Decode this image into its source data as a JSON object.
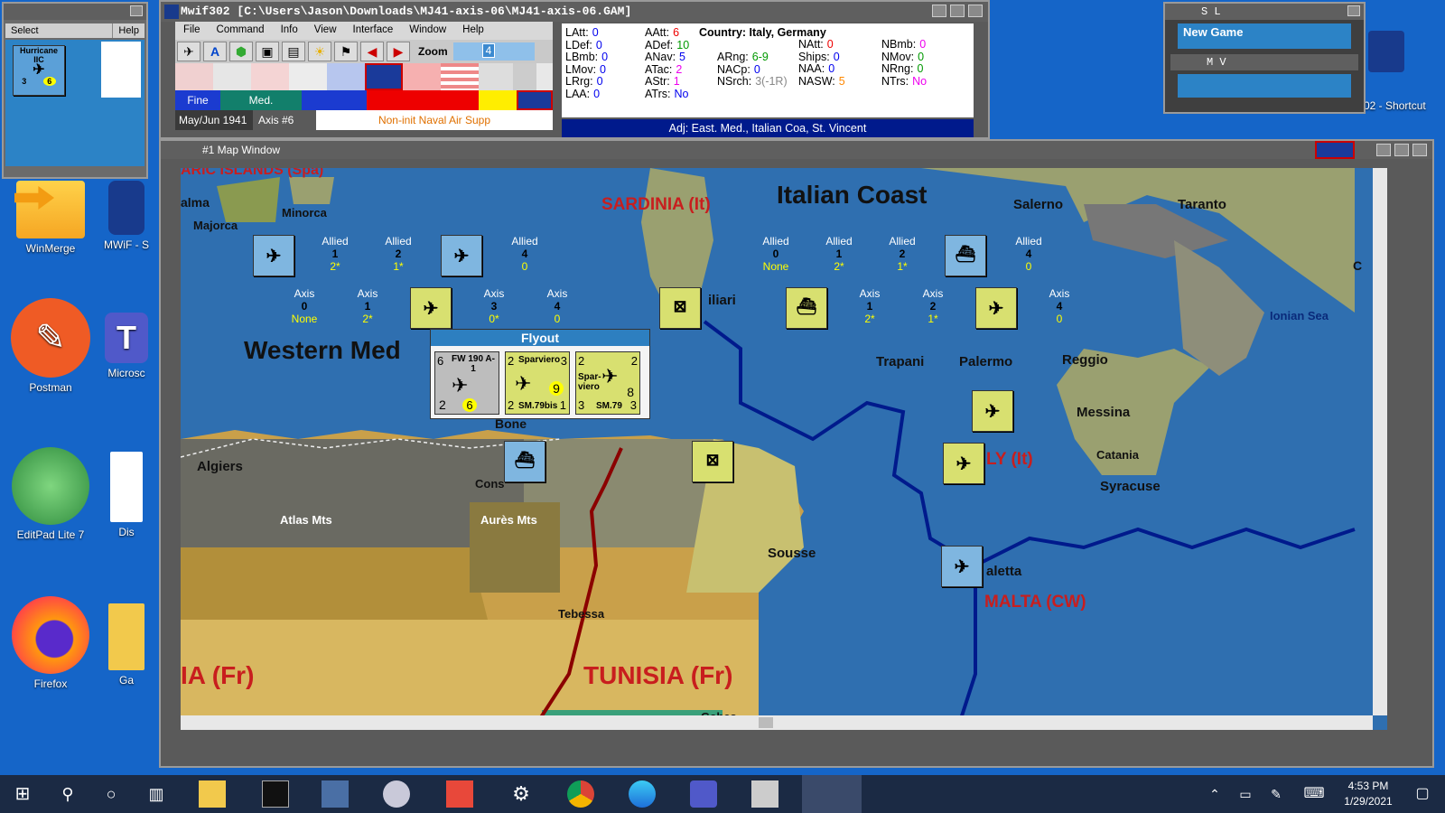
{
  "desktop": {
    "icons": [
      {
        "label": "WinMerge"
      },
      {
        "label": "MWiF - S"
      },
      {
        "label": "Postman"
      },
      {
        "label": "Microsc"
      },
      {
        "label": "EditPad Lite 7"
      },
      {
        "label": "Dis"
      },
      {
        "label": "Firefox"
      },
      {
        "label": "Ga"
      }
    ],
    "shortcut_label": "02 - Shortcut"
  },
  "select_window": {
    "menu": [
      "Select",
      "Help"
    ],
    "counter_name": "Hurricane",
    "counter_top": "IIC",
    "counter_a": "3",
    "counter_b": "6"
  },
  "sl_window": {
    "title": "S L",
    "new_game": "New Game",
    "mv_title": "M V"
  },
  "main_window": {
    "title": "Mwif302 [C:\\Users\\Jason\\Downloads\\MJ41-axis-06\\MJ41-axis-06.GAM]",
    "menu": [
      "File",
      "Command",
      "Info",
      "View",
      "Interface",
      "Window",
      "Help"
    ],
    "zoom_label": "Zoom",
    "zoom_value": "4",
    "weather": [
      "Fine",
      "Med."
    ],
    "date": "May/Jun 1941",
    "turn": "Axis #6",
    "phase": "Non-init Naval Air Supp",
    "adjacent": "Adj: East. Med., Italian Coa, St. Vincent"
  },
  "info_panel": {
    "country": "Country: Italy, Germany",
    "col1": [
      [
        "LAtt:",
        "0"
      ],
      [
        "LDef:",
        "0"
      ],
      [
        "LBmb:",
        "0"
      ],
      [
        "LMov:",
        "0"
      ],
      [
        "LRrg:",
        "0"
      ],
      [
        "LAA:",
        "0"
      ]
    ],
    "col2": [
      [
        "AAtt:",
        "6"
      ],
      [
        "ADef:",
        "10"
      ],
      [
        "ANav:",
        "5"
      ],
      [
        "ATac:",
        "2"
      ],
      [
        "AStr:",
        "1"
      ],
      [
        "ATrs:",
        "No"
      ]
    ],
    "col3": [
      [
        "ARng:",
        "6-9"
      ],
      [
        "NACp:",
        "0"
      ],
      [
        "NSrch:",
        "3(-1R)"
      ]
    ],
    "col4": [
      [
        "NAtt:",
        "0"
      ],
      [
        "Ships:",
        "0"
      ],
      [
        "NAA:",
        "0"
      ],
      [
        "NASW:",
        "5"
      ]
    ],
    "col5": [
      [
        "NBmb:",
        "0"
      ],
      [
        "NMov:",
        "0"
      ],
      [
        "NRng:",
        "0"
      ],
      [
        "NTrs:",
        "No"
      ]
    ]
  },
  "map_window": {
    "title": "#1 Map Window",
    "sea_labels": [
      "Western Med",
      "Italian Coast",
      "Ionian Sea"
    ],
    "country_labels": [
      "SARDINIA (It)",
      "TUNISIA (Fr)",
      "IA (Fr)",
      "MALTA (CW)",
      "LY (It)"
    ],
    "places": [
      "ARIC ISLANDS (Spa)",
      "alma",
      "Minorca",
      "Majorca",
      "Algiers",
      "Atlas Mts",
      "Aurès Mts",
      "Bone",
      "Cons",
      "Tebessa",
      "Sousse",
      "Gabes",
      "Trapani",
      "Palermo",
      "Reggio",
      "Messina",
      "Catania",
      "Syracuse",
      "Salerno",
      "Taranto",
      "aletta",
      "iliari",
      "C"
    ],
    "allied_boxes": [
      {
        "top": "Allied",
        "mid": "1",
        "bot": "2*"
      },
      {
        "top": "Allied",
        "mid": "2",
        "bot": "1*"
      },
      {
        "top": "Allied",
        "mid": "4",
        "bot": "0"
      },
      {
        "top": "Allied",
        "mid": "0",
        "bot": "None"
      },
      {
        "top": "Allied",
        "mid": "1",
        "bot": "2*"
      },
      {
        "top": "Allied",
        "mid": "2",
        "bot": "1*"
      },
      {
        "top": "Allied",
        "mid": "4",
        "bot": "0"
      }
    ],
    "axis_boxes": [
      {
        "top": "Axis",
        "mid": "0",
        "bot": "None"
      },
      {
        "top": "Axis",
        "mid": "1",
        "bot": "2*"
      },
      {
        "top": "Axis",
        "mid": "3",
        "bot": "0*"
      },
      {
        "top": "Axis",
        "mid": "4",
        "bot": "0"
      },
      {
        "top": "Axis",
        "mid": "1",
        "bot": "2*"
      },
      {
        "top": "Axis",
        "mid": "2",
        "bot": "1*"
      },
      {
        "top": "Axis",
        "mid": "4",
        "bot": "0"
      }
    ],
    "flyout": {
      "title": "Flyout",
      "units": [
        {
          "name": "FW 190 A-1",
          "left": "6",
          "a": "2",
          "b": "6"
        },
        {
          "name": "Sparviero",
          "left": "2",
          "right": "3",
          "a": "2",
          "b": "9",
          "sub": "SM.79bis",
          "c": "1"
        },
        {
          "name": "Spar-viero",
          "left": "2",
          "right": "2",
          "a": "3",
          "b": "8",
          "sub": "SM.79",
          "c": "3"
        }
      ]
    }
  },
  "taskbar": {
    "time": "4:53 PM",
    "date": "1/29/2021"
  }
}
